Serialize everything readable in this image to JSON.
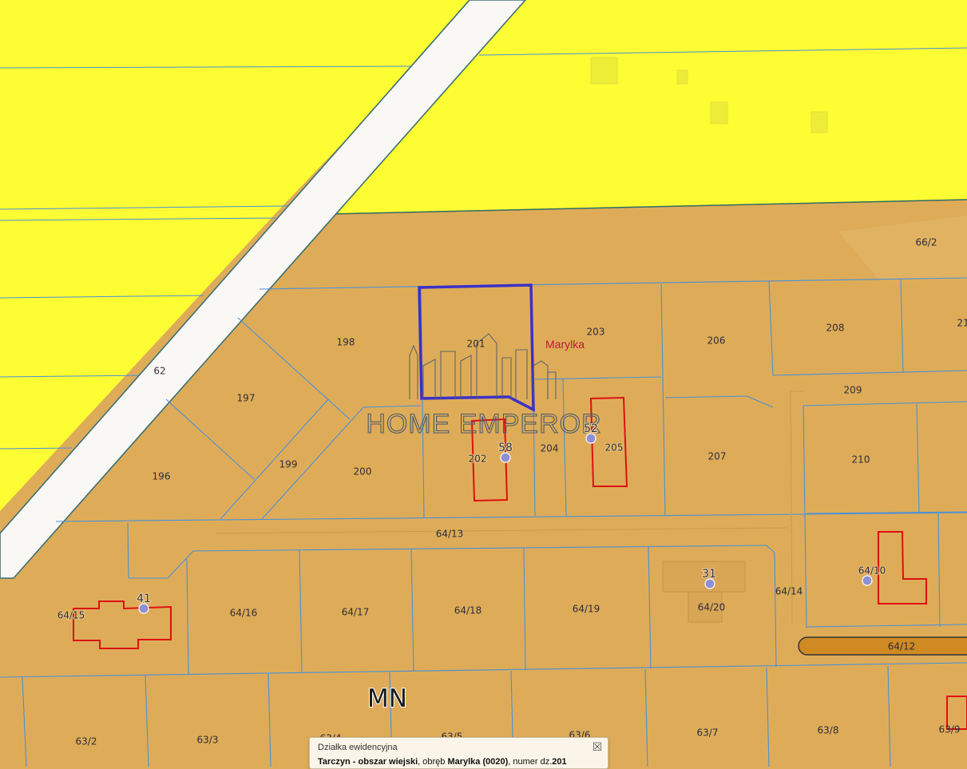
{
  "map": {
    "zone_label": "MN",
    "place_name": "Marylka",
    "watermark": "HOME EMPEROR",
    "colors": {
      "agricultural_zone": "#fdfd33",
      "residential_zone": "#deac58",
      "road": "#faf8f4",
      "parcel_line": "#4a90d9",
      "selected_parcel": "#3b30c8",
      "building_outline": "#dd1111",
      "path_fill": "#cf8a24"
    },
    "parcels": {
      "p62": "62",
      "p66_2": "66/2",
      "p196": "196",
      "p197": "197",
      "p198": "198",
      "p199": "199",
      "p200": "200",
      "p201": "201",
      "p202": "202",
      "p203": "203",
      "p204": "204",
      "p205": "205",
      "p206": "206",
      "p207": "207",
      "p208": "208",
      "p209": "209",
      "p210": "210",
      "p21x": "21",
      "p64_10": "64/10",
      "p64_12": "64/12",
      "p64_13": "64/13",
      "p64_14": "64/14",
      "p64_15": "64/15",
      "p64_16": "64/16",
      "p64_17": "64/17",
      "p64_18": "64/18",
      "p64_19": "64/19",
      "p64_20": "64/20",
      "p63_2": "63/2",
      "p63_3": "63/3",
      "p63_4": "63/4",
      "p63_5": "63/5",
      "p63_6": "63/6",
      "p63_7": "63/7",
      "p63_8": "63/8",
      "p63_9": "63/9"
    },
    "buildings": {
      "b58": "58",
      "b52": "52",
      "b31": "31",
      "b41": "41"
    }
  },
  "popup": {
    "title": "Działka ewidencyjna",
    "area_name": "Tarczyn - obszar wiejski",
    "text_obreb": ", obręb ",
    "obreb": "Marylka (0020)",
    "text_numer": ", numer dz.",
    "number": "201",
    "close_icon": "close-x-icon"
  }
}
